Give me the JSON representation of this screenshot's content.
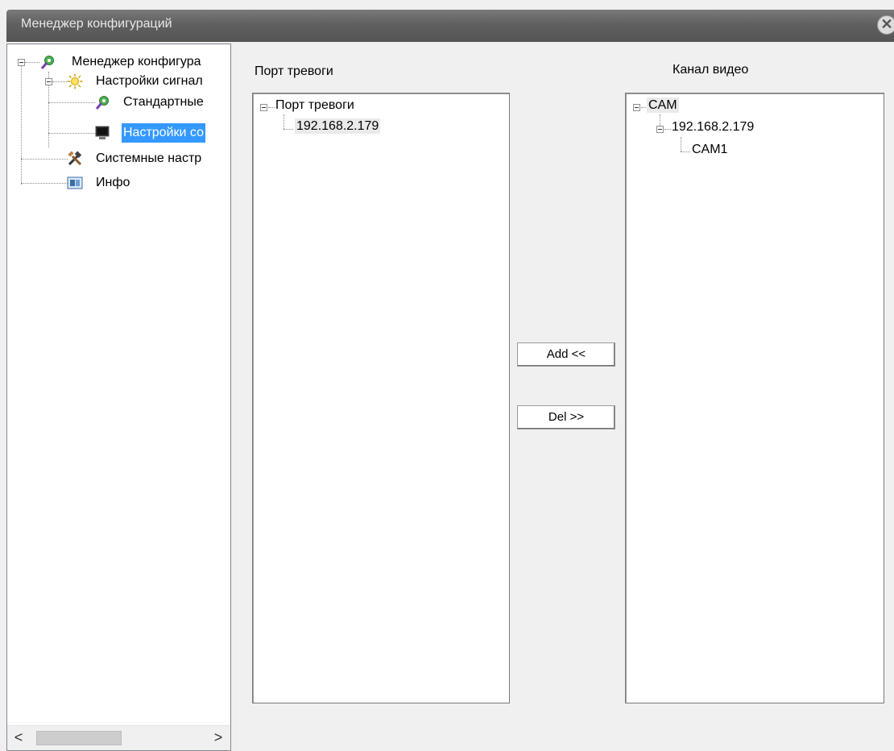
{
  "window": {
    "title": "Менеджер конфигураций",
    "close_icon": "close-icon"
  },
  "nav_tree": {
    "items": [
      {
        "label": "Менеджер конфигура",
        "icon": "config-manager-icon"
      },
      {
        "label": "Настройки сигнал",
        "icon": "alarm-settings-icon"
      },
      {
        "label": "Стандартные",
        "icon": "standard-settings-icon"
      },
      {
        "label": "Настройки со",
        "icon": "monitor-icon",
        "selected": true
      },
      {
        "label": "Системные настр",
        "icon": "tools-icon"
      },
      {
        "label": "Инфо",
        "icon": "info-icon"
      }
    ],
    "scroll_left": "<",
    "scroll_right": ">"
  },
  "alarm_port": {
    "header": "Порт тревоги",
    "root": "Порт тревоги",
    "children": [
      "192.168.2.179"
    ]
  },
  "video_channel": {
    "header": "Канал видео",
    "root": "CAM",
    "device": "192.168.2.179",
    "channel": "CAM1"
  },
  "buttons": {
    "add": "Add <<",
    "del": "Del >>"
  },
  "colors": {
    "selection": "#3399ff",
    "titlebar": "#606060"
  }
}
